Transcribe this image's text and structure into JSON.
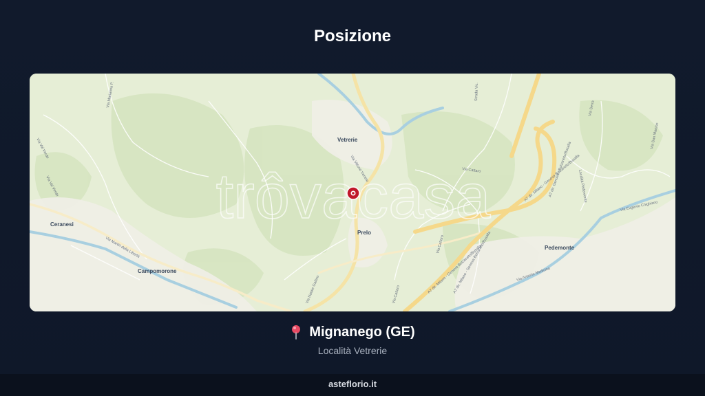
{
  "title": "Posizione",
  "map": {
    "watermark": "trôvacasa",
    "towns": {
      "vetrerie": "Vetrerie",
      "ceranesi": "Ceranesi",
      "campomorone": "Campomorone",
      "prelo": "Prelo",
      "pedemonte": "Pedemonte"
    },
    "roads": {
      "via_vigo_verde": "Via Val Verde",
      "via_sp_campomorone": "Via Val Verde",
      "via_marzanna": "Via Marianna P.",
      "via_vittorio_veneto": "Via Vittorio Veneto",
      "via_della_liberta": "Via Martiri della Libertà",
      "via_natale_gallino": "Via Natale Gallino",
      "via_cattaro": "Via Cattaro",
      "via_carcano": "Via Cattaro",
      "via_cattaro2": "Via Cattaro",
      "a7_1": "A7 dir. Milano - Genova Bolzaneto/Busalla",
      "a7_2": "A7 dir. Milano - Genova Bolzaneto/Busalla",
      "a7_3": "A7 dir. Genova - Bolzaneto/Busalla",
      "a7_4": "A7 dir. Milano - Genova Bolzaneto/Busalla",
      "via_eugenio_chighiano": "Via Eugenio Chighiano",
      "via_antonio_medicina": "Via Antonio Medicina",
      "via_serra": "Via Serra",
      "via_san_martino": "Via San Martino",
      "via_pedemonte": "Località Pedemonte",
      "strada": "Strada Vic."
    },
    "marker": "location-pin"
  },
  "location": {
    "pin_icon": "pin-icon",
    "name": "Mignanego (GE)",
    "locality": "Località Vetrerie"
  },
  "footer": {
    "site": "asteflorio.it"
  },
  "colors": {
    "background": "#111a2c",
    "marker": "#c0182a",
    "highway": "#f5d88a",
    "river": "#a8cfe0"
  }
}
